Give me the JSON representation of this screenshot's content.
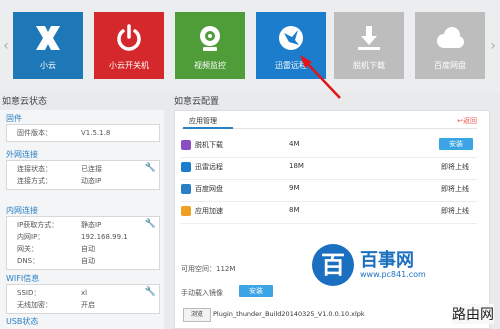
{
  "tiles": [
    {
      "label": "小云",
      "color": "#1e78b8",
      "icon": "x-logo-icon"
    },
    {
      "label": "小云开关机",
      "color": "#d5282c",
      "icon": "power-icon"
    },
    {
      "label": "视频监控",
      "color": "#4e9d39",
      "icon": "webcam-icon"
    },
    {
      "label": "迅雷远程",
      "color": "#1b7dcc",
      "icon": "thunder-bird-icon"
    },
    {
      "label": "脱机下载",
      "color": "#bdbdbd",
      "icon": "download-icon"
    },
    {
      "label": "百度网盘",
      "color": "#bdbdbd",
      "icon": "cloud-icon"
    }
  ],
  "status": {
    "title": "如意云状态",
    "firmware": {
      "head": "固件",
      "rows": [
        {
          "k": "固件版本：",
          "v": "V1.5.1.8"
        }
      ]
    },
    "external": {
      "head": "外网连接",
      "rows": [
        {
          "k": "连接状态：",
          "v": "已连接"
        },
        {
          "k": "连接方式：",
          "v": "动态IP"
        }
      ]
    },
    "internal": {
      "head": "内网连接",
      "rows": [
        {
          "k": "IP获取方式：",
          "v": "静态IP"
        },
        {
          "k": "内网IP：",
          "v": "192.168.99.1"
        },
        {
          "k": "网关：",
          "v": "自动"
        },
        {
          "k": "DNS：",
          "v": "自动"
        }
      ]
    },
    "wifi": {
      "head": "WIFI信息",
      "rows": [
        {
          "k": "SSID：",
          "v": "xl"
        },
        {
          "k": "无线加密：",
          "v": "开启"
        }
      ]
    },
    "usb": {
      "head": "USB状态"
    }
  },
  "config": {
    "title": "如意云配置",
    "tab": "应用管理",
    "back": "返回",
    "apps": [
      {
        "name": "脱机下载",
        "size": "4M",
        "status": "安装",
        "color": "#8a4ec2",
        "is_button": true
      },
      {
        "name": "迅雷远程",
        "size": "18M",
        "status": "即将上线",
        "color": "#1b7dcc",
        "is_button": false
      },
      {
        "name": "百度网盘",
        "size": "9M",
        "status": "即将上线",
        "color": "#2a7fc4",
        "is_button": false
      },
      {
        "name": "应用加速",
        "size": "8M",
        "status": "即将上线",
        "color": "#f0a020",
        "is_button": false
      }
    ],
    "space": "可用空间：112M",
    "manual": "手动载入镜像",
    "manual_btn": "安装",
    "browse": "浏览",
    "filename": "Plugin_thunder_Build20140325_V1.0.0.10.xlpk"
  },
  "watermark": {
    "logo": "百",
    "cn": "百事网",
    "url": "www.pc841.com",
    "corner": "路由网"
  },
  "accent": "#2a7fc4",
  "annotation_color": "#e3151b"
}
